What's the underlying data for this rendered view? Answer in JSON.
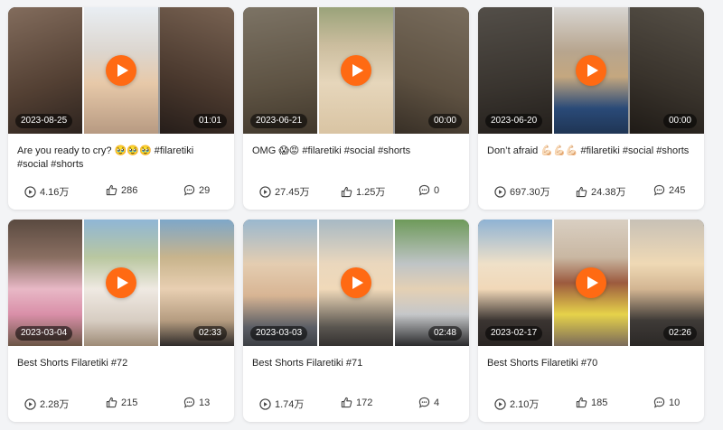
{
  "colors": {
    "accent": "#ff6a13",
    "card": "#ffffff",
    "page": "#f3f4f6"
  },
  "icons": {
    "views": "play-circle-icon",
    "likes": "thumbs-up-icon",
    "comments": "comment-bubble-icon"
  },
  "videos": [
    {
      "date": "2023-08-25",
      "duration": "01:01",
      "title": "Are you ready to cry? 🥹🥹🥹 #filaretiki #social #shorts",
      "views": "4.16万",
      "likes": "286",
      "comments": "29"
    },
    {
      "date": "2023-06-21",
      "duration": "00:00",
      "title": "OMG 😱😡 #filaretiki #social #shorts",
      "views": "27.45万",
      "likes": "1.25万",
      "comments": "0"
    },
    {
      "date": "2023-06-20",
      "duration": "00:00",
      "title": "Don’t afraid 💪🏻💪🏻💪🏻 #filaretiki #social #shorts",
      "views": "697.30万",
      "likes": "24.38万",
      "comments": "245"
    },
    {
      "date": "2023-03-04",
      "duration": "02:33",
      "title": "Best Shorts Filaretiki #72",
      "views": "2.28万",
      "likes": "215",
      "comments": "13"
    },
    {
      "date": "2023-03-03",
      "duration": "02:48",
      "title": "Best Shorts Filaretiki #71",
      "views": "1.74万",
      "likes": "172",
      "comments": "4"
    },
    {
      "date": "2023-02-17",
      "duration": "02:26",
      "title": "Best Shorts Filaretiki #70",
      "views": "2.10万",
      "likes": "185",
      "comments": "10"
    }
  ]
}
